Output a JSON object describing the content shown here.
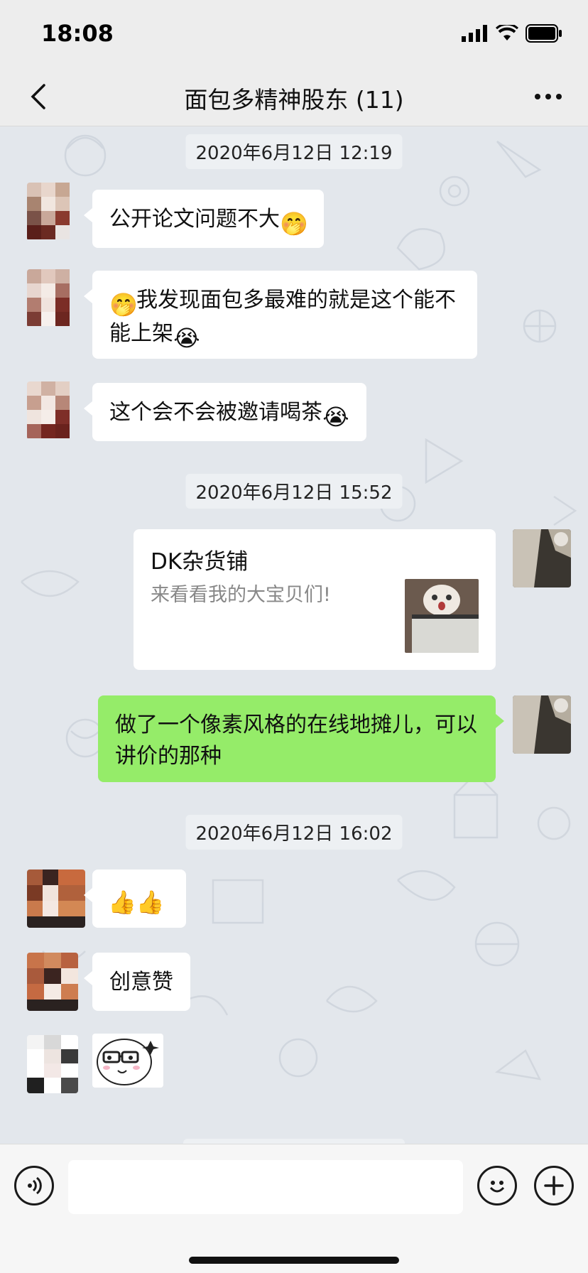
{
  "status_bar": {
    "time": "18:08"
  },
  "header": {
    "title": "面包多精神股东 (11)"
  },
  "timestamps": [
    "2020年6月12日 12:19",
    "2020年6月12日 15:52",
    "2020年6月12日 16:02"
  ],
  "messages": {
    "m1": {
      "text": "公开论文问题不大",
      "emoji": "🤭"
    },
    "m2": {
      "emoji_start": "🤭",
      "text": "我发现面包多最难的就是这个能不能上架",
      "emoji": "😭"
    },
    "m3": {
      "text": "这个会不会被邀请喝茶",
      "emoji": "😭"
    },
    "card": {
      "title": "DK杂货铺",
      "desc": "来看看我的大宝贝们!"
    },
    "m5": {
      "text": "做了一个像素风格的在线地摊儿，可以讲价的那种"
    },
    "m6": {
      "emoji": "👍👍"
    },
    "m7": {
      "text": "创意赞"
    }
  },
  "input": {
    "placeholder": ""
  },
  "colors": {
    "outgoing_bubble": "#95ec69",
    "incoming_bubble": "#ffffff",
    "chat_bg": "#e3e7ec"
  }
}
